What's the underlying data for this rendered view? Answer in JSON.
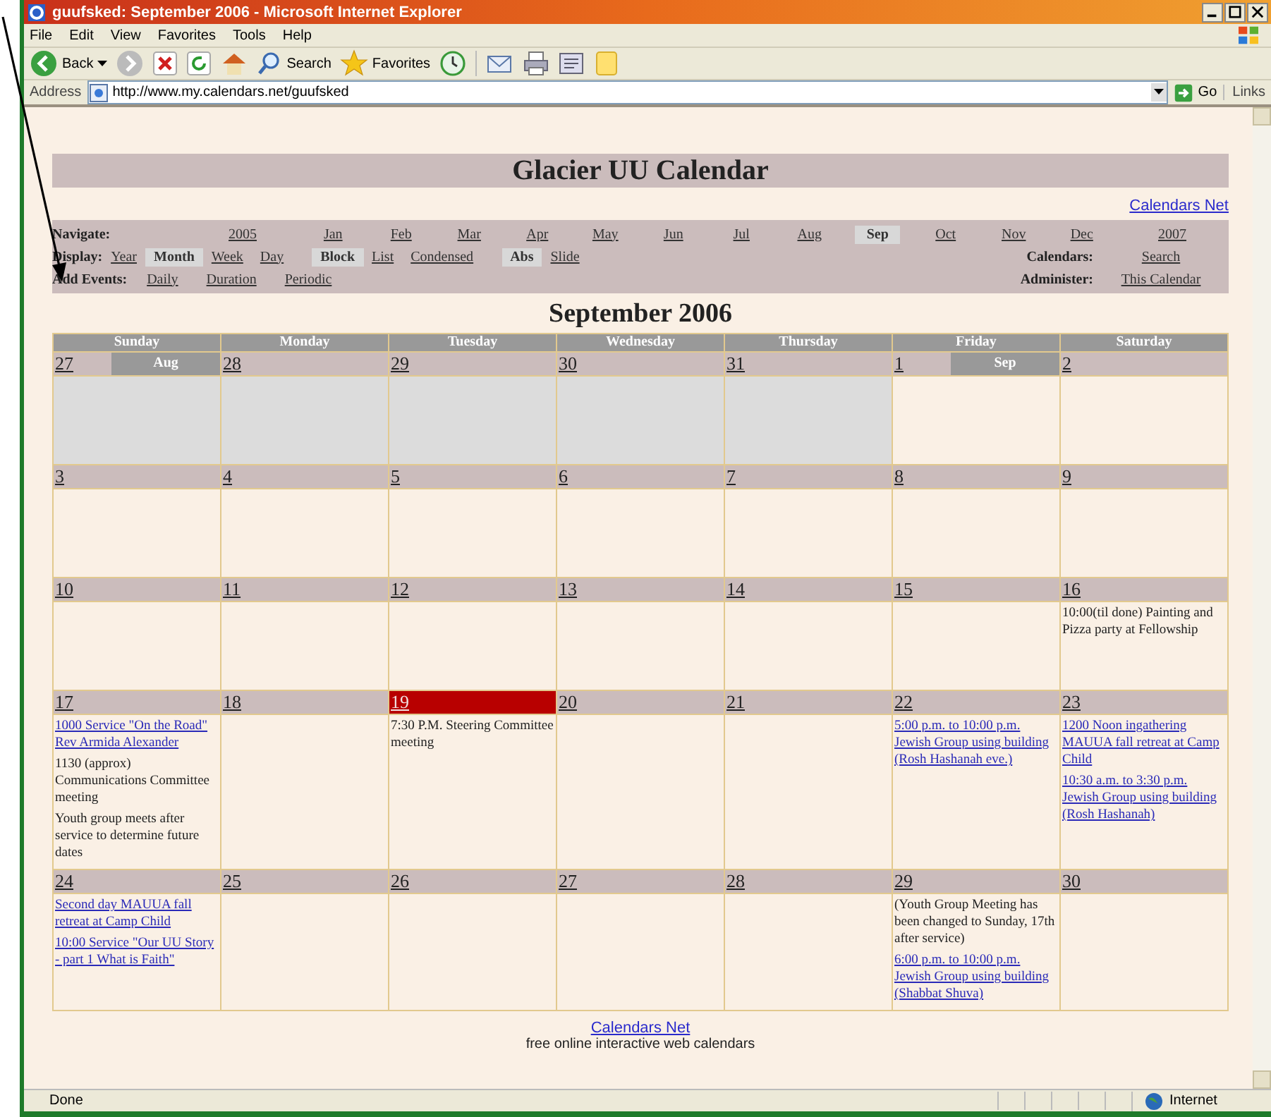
{
  "window": {
    "title": "guufsked: September 2006 - Microsoft Internet Explorer"
  },
  "menu": [
    "File",
    "Edit",
    "View",
    "Favorites",
    "Tools",
    "Help"
  ],
  "toolbar": {
    "back": "Back",
    "search": "Search",
    "favorites": "Favorites"
  },
  "address": {
    "label": "Address",
    "url": "http://www.my.calendars.net/guufsked",
    "go": "Go",
    "links": "Links"
  },
  "page": {
    "title": "Glacier UU Calendar",
    "top_link": "Calendars Net",
    "navigate": {
      "label": "Navigate:",
      "items": [
        {
          "text": "2005",
          "selected": false
        },
        {
          "text": "Jan",
          "selected": false
        },
        {
          "text": "Feb",
          "selected": false
        },
        {
          "text": "Mar",
          "selected": false
        },
        {
          "text": "Apr",
          "selected": false
        },
        {
          "text": "May",
          "selected": false
        },
        {
          "text": "Jun",
          "selected": false
        },
        {
          "text": "Jul",
          "selected": false
        },
        {
          "text": "Aug",
          "selected": false
        },
        {
          "text": "Sep",
          "selected": true
        },
        {
          "text": "Oct",
          "selected": false
        },
        {
          "text": "Nov",
          "selected": false
        },
        {
          "text": "Dec",
          "selected": false
        },
        {
          "text": "2007",
          "selected": false
        }
      ]
    },
    "display": {
      "label": "Display:",
      "groups": [
        [
          {
            "text": "Year",
            "selected": false
          },
          {
            "text": "Month",
            "selected": true
          },
          {
            "text": "Week",
            "selected": false
          },
          {
            "text": "Day",
            "selected": false
          }
        ],
        [
          {
            "text": "Block",
            "selected": true
          },
          {
            "text": "List",
            "selected": false
          },
          {
            "text": "Condensed",
            "selected": false
          }
        ],
        [
          {
            "text": "Abs",
            "selected": true
          },
          {
            "text": "Slide",
            "selected": false
          }
        ]
      ]
    },
    "add_events": {
      "label": "Add Events:",
      "items": [
        "Daily",
        "Duration",
        "Periodic"
      ]
    },
    "calendars": {
      "label": "Calendars:",
      "link": "Search"
    },
    "administer": {
      "label": "Administer:",
      "link": "This Calendar"
    },
    "month_title": "September 2006",
    "weekdays": [
      "Sunday",
      "Monday",
      "Tuesday",
      "Wednesday",
      "Thursday",
      "Friday",
      "Saturday"
    ],
    "weeks": [
      {
        "days": [
          {
            "date": "27",
            "in_month": false,
            "today": false,
            "month_label": "Aug"
          },
          {
            "date": "28",
            "in_month": false,
            "today": false
          },
          {
            "date": "29",
            "in_month": false,
            "today": false
          },
          {
            "date": "30",
            "in_month": false,
            "today": false
          },
          {
            "date": "31",
            "in_month": false,
            "today": false
          },
          {
            "date": "1",
            "in_month": true,
            "today": false,
            "month_label": "Sep"
          },
          {
            "date": "2",
            "in_month": true,
            "today": false
          }
        ]
      },
      {
        "days": [
          {
            "date": "3",
            "in_month": true,
            "today": false
          },
          {
            "date": "4",
            "in_month": true,
            "today": false
          },
          {
            "date": "5",
            "in_month": true,
            "today": false
          },
          {
            "date": "6",
            "in_month": true,
            "today": false
          },
          {
            "date": "7",
            "in_month": true,
            "today": false
          },
          {
            "date": "8",
            "in_month": true,
            "today": false
          },
          {
            "date": "9",
            "in_month": true,
            "today": false
          }
        ]
      },
      {
        "days": [
          {
            "date": "10",
            "in_month": true,
            "today": false
          },
          {
            "date": "11",
            "in_month": true,
            "today": false
          },
          {
            "date": "12",
            "in_month": true,
            "today": false
          },
          {
            "date": "13",
            "in_month": true,
            "today": false
          },
          {
            "date": "14",
            "in_month": true,
            "today": false
          },
          {
            "date": "15",
            "in_month": true,
            "today": false
          },
          {
            "date": "16",
            "in_month": true,
            "today": false,
            "events": [
              {
                "text": "10:00(til done) Painting and Pizza party at Fellowship",
                "link": false
              }
            ]
          }
        ]
      },
      {
        "days": [
          {
            "date": "17",
            "in_month": true,
            "today": false,
            "events": [
              {
                "text": "1000 Service \"On the Road\" Rev Armida Alexander",
                "link": true
              },
              {
                "text": "1130 (approx) Communications Committee meeting",
                "link": false
              },
              {
                "text": "Youth group meets after service to determine future dates",
                "link": false
              }
            ]
          },
          {
            "date": "18",
            "in_month": true,
            "today": false
          },
          {
            "date": "19",
            "in_month": true,
            "today": true,
            "events": [
              {
                "text": "7:30 P.M. Steering Committee meeting",
                "link": false
              }
            ]
          },
          {
            "date": "20",
            "in_month": true,
            "today": false
          },
          {
            "date": "21",
            "in_month": true,
            "today": false
          },
          {
            "date": "22",
            "in_month": true,
            "today": false,
            "events": [
              {
                "text": "5:00 p.m. to 10:00 p.m. Jewish Group using building (Rosh Hashanah eve.)",
                "link": true
              }
            ]
          },
          {
            "date": "23",
            "in_month": true,
            "today": false,
            "events": [
              {
                "text": "1200 Noon ingathering MAUUA fall retreat at Camp Child",
                "link": true
              },
              {
                "text": "10:30 a.m. to 3:30 p.m. Jewish Group using building (Rosh Hashanah)",
                "link": true
              }
            ]
          }
        ]
      },
      {
        "days": [
          {
            "date": "24",
            "in_month": true,
            "today": false,
            "events": [
              {
                "text": "Second day MAUUA fall retreat at Camp Child",
                "link": true
              },
              {
                "text": "10:00 Service \"Our UU Story - part 1 What is Faith\"",
                "link": true
              }
            ]
          },
          {
            "date": "25",
            "in_month": true,
            "today": false
          },
          {
            "date": "26",
            "in_month": true,
            "today": false
          },
          {
            "date": "27",
            "in_month": true,
            "today": false
          },
          {
            "date": "28",
            "in_month": true,
            "today": false
          },
          {
            "date": "29",
            "in_month": true,
            "today": false,
            "events": [
              {
                "text": "(Youth Group Meeting has been changed to Sunday, 17th after service)",
                "link": false
              },
              {
                "text": "6:00 p.m. to 10:00 p.m. Jewish Group using building (Shabbat Shuva)",
                "link": true
              }
            ]
          },
          {
            "date": "30",
            "in_month": true,
            "today": false
          }
        ]
      }
    ],
    "footer": {
      "link": "Calendars Net",
      "tagline": "free online interactive web calendars"
    }
  },
  "status_bar": {
    "text": "Done",
    "zone": "Internet"
  }
}
